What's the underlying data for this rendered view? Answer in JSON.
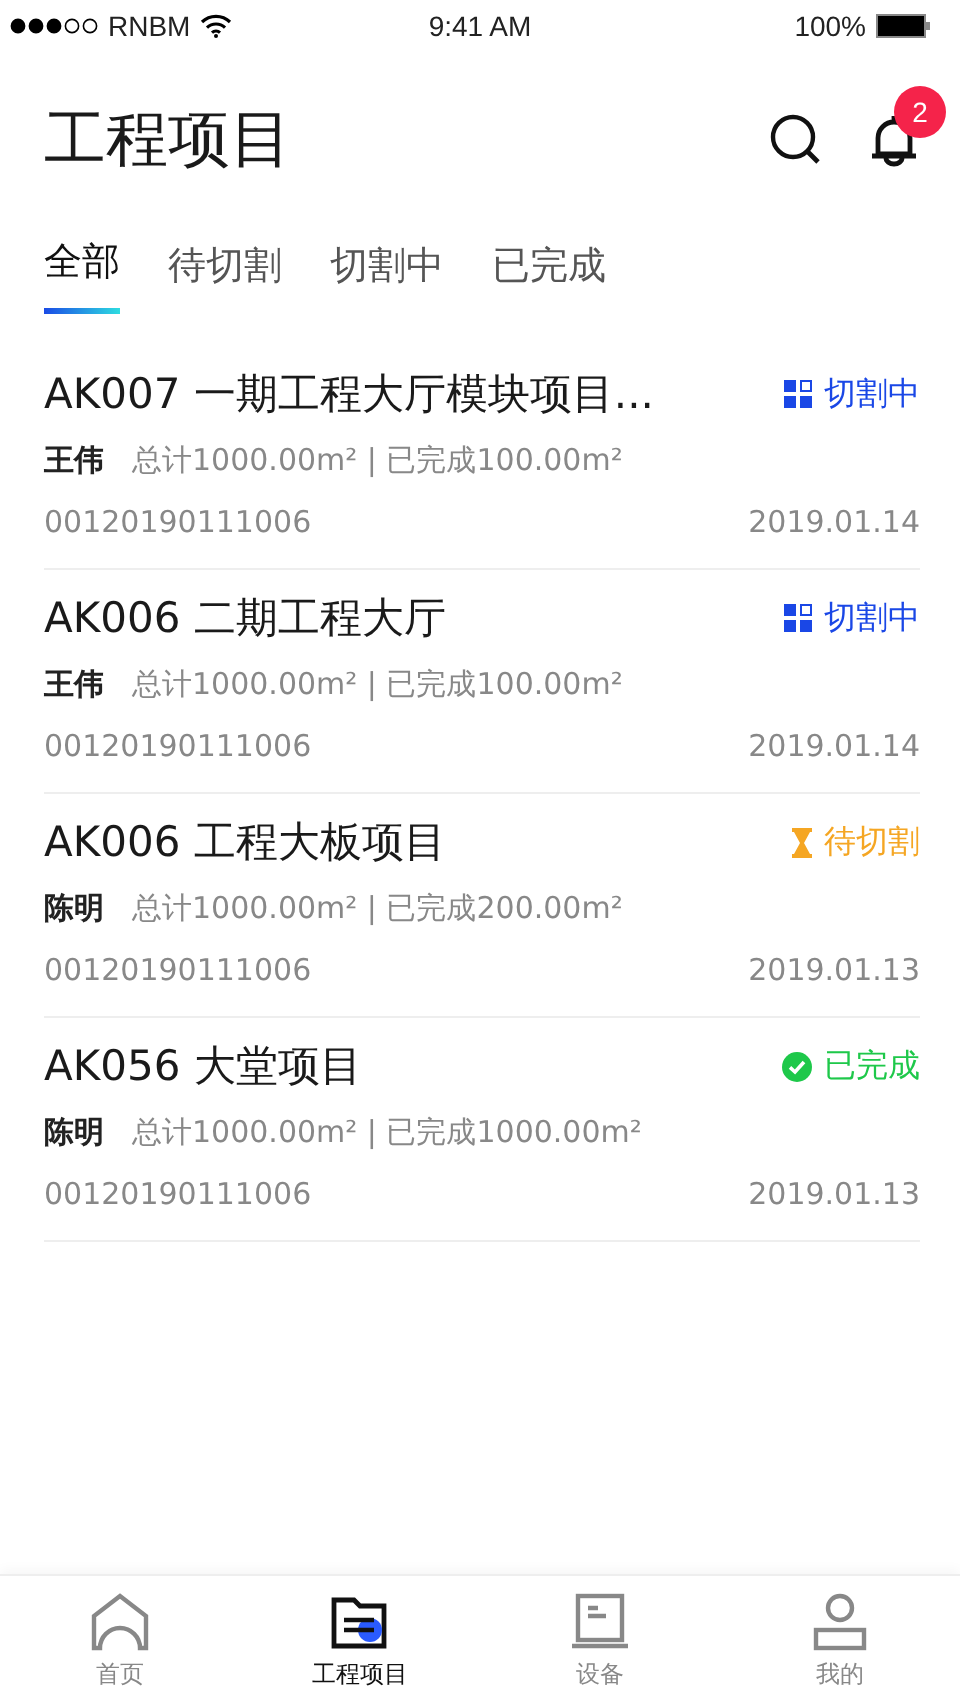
{
  "status_bar": {
    "carrier": "RNBM",
    "time": "9:41 AM",
    "battery": "100%"
  },
  "header": {
    "title": "工程项目",
    "notification_count": "2"
  },
  "tabs": [
    {
      "label": "全部",
      "selected": true
    },
    {
      "label": "待切割",
      "selected": false
    },
    {
      "label": "切割中",
      "selected": false
    },
    {
      "label": "已完成",
      "selected": false
    }
  ],
  "projects": [
    {
      "title": "AK007 一期工程大厅模块项目...",
      "status": "切割中",
      "kind": "cutting",
      "owner": "王伟",
      "summary": "总计1000.00m² | 已完成100.00m²",
      "code": "00120190111006",
      "date": "2019.01.14"
    },
    {
      "title": "AK006 二期工程大厅",
      "status": "切割中",
      "kind": "cutting",
      "owner": "王伟",
      "summary": "总计1000.00m² | 已完成100.00m²",
      "code": "00120190111006",
      "date": "2019.01.14"
    },
    {
      "title": "AK006 工程大板项目",
      "status": "待切割",
      "kind": "waiting",
      "owner": "陈明",
      "summary": "总计1000.00m² | 已完成200.00m²",
      "code": "00120190111006",
      "date": "2019.01.13"
    },
    {
      "title": "AK056 大堂项目",
      "status": "已完成",
      "kind": "done",
      "owner": "陈明",
      "summary": "总计1000.00m² | 已完成1000.00m²",
      "code": "00120190111006",
      "date": "2019.01.13"
    }
  ],
  "bottom_nav": [
    {
      "label": "首页",
      "kind": "home",
      "selected": false
    },
    {
      "label": "工程项目",
      "kind": "projects",
      "selected": true
    },
    {
      "label": "设备",
      "kind": "device",
      "selected": false
    },
    {
      "label": "我的",
      "kind": "profile",
      "selected": false
    }
  ]
}
